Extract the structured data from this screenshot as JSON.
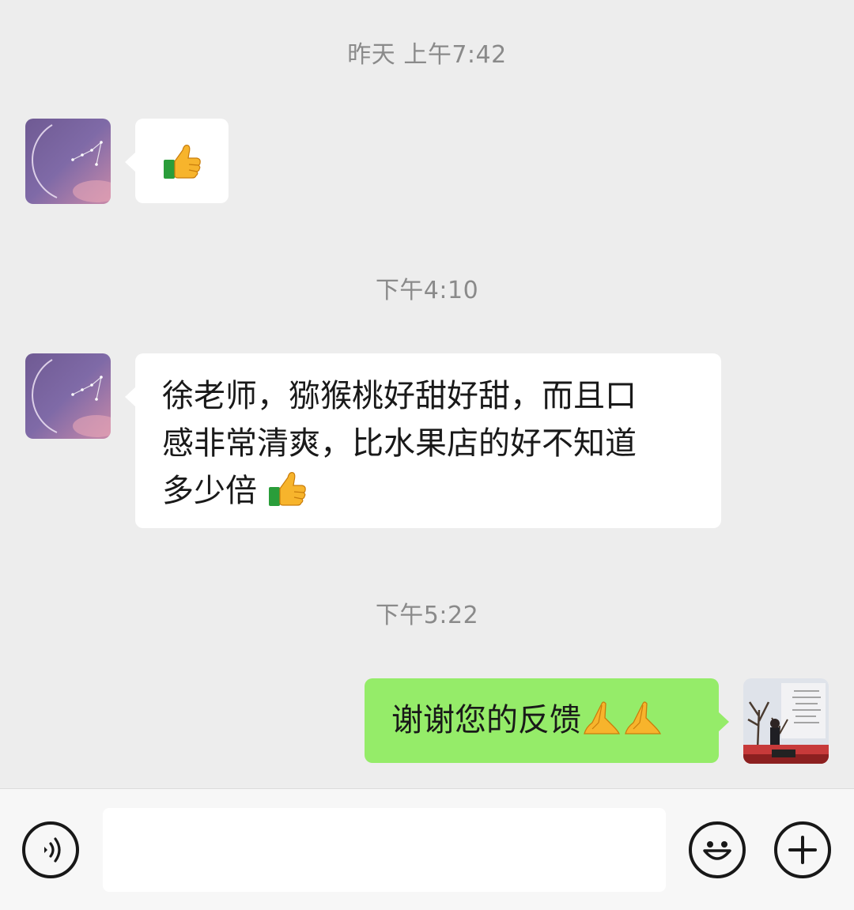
{
  "messages": [
    {
      "type": "timestamp",
      "text": "昨天 上午7:42"
    },
    {
      "type": "incoming",
      "sender_avatar": "avatar-purple-night",
      "emoji": [
        "thumbs-up-icon"
      ]
    },
    {
      "type": "timestamp",
      "text": "下午4:10"
    },
    {
      "type": "incoming",
      "sender_avatar": "avatar-purple-night",
      "lines": [
        "徐老师，猕猴桃好甜好甜，而且口",
        "感非常清爽，比水果店的好不知道",
        "多少倍"
      ],
      "emoji": [
        "thumbs-up-icon"
      ]
    },
    {
      "type": "timestamp",
      "text": "下午5:22"
    },
    {
      "type": "outgoing",
      "sender_avatar": "avatar-stage-photo",
      "text": "谢谢您的反馈",
      "emoji": [
        "folded-hands-icon",
        "folded-hands-icon"
      ]
    }
  ],
  "colors": {
    "background": "#ededed",
    "incoming_bubble": "#ffffff",
    "outgoing_bubble": "#95ec69",
    "timestamp": "#8a8a8a"
  },
  "input_bar": {
    "voice_icon": "voice-icon",
    "emoji_icon": "smiley-icon",
    "more_icon": "plus-icon",
    "text_value": ""
  }
}
